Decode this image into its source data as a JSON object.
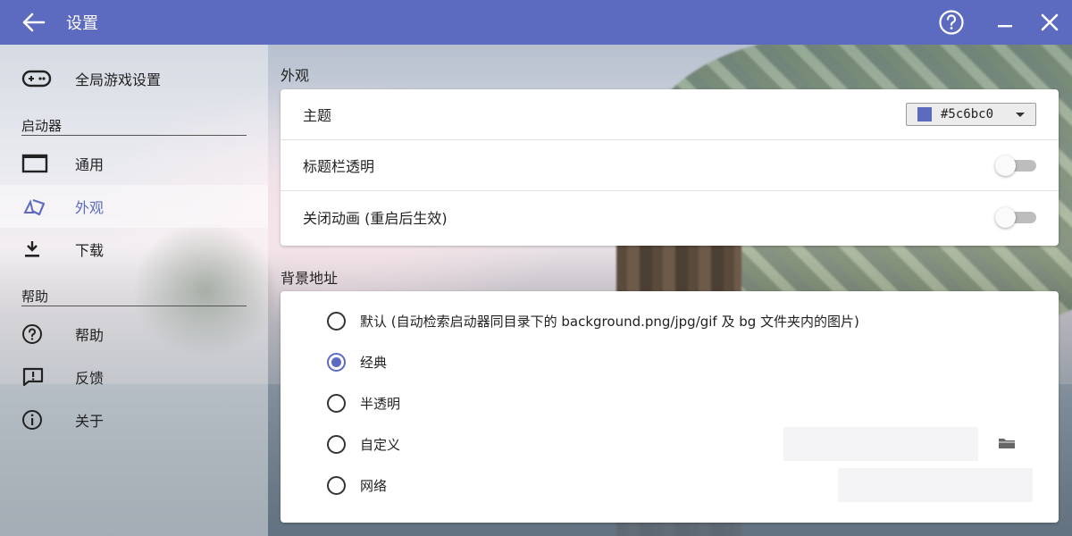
{
  "window": {
    "title": "设置",
    "accent_color": "#5c6bc0"
  },
  "titlebar": {
    "back_icon": "arrow-left-icon",
    "help_icon": "help-circle-icon",
    "minimize_icon": "minimize-icon",
    "close_icon": "close-icon"
  },
  "sidebar": {
    "top_item": {
      "label": "全局游戏设置",
      "icon": "gamepad-icon"
    },
    "section_launcher": "启动器",
    "launcher_items": [
      {
        "label": "通用",
        "icon": "window-icon"
      },
      {
        "label": "外观",
        "icon": "palette-icon",
        "active": true
      },
      {
        "label": "下载",
        "icon": "download-icon"
      }
    ],
    "section_help": "帮助",
    "help_items": [
      {
        "label": "帮助",
        "icon": "help-circle-icon"
      },
      {
        "label": "反馈",
        "icon": "feedback-icon"
      },
      {
        "label": "关于",
        "icon": "info-icon"
      }
    ]
  },
  "appearance": {
    "title": "外观",
    "theme_label": "主题",
    "theme_value": "#5c6bc0",
    "titlebar_transparent_label": "标题栏透明",
    "titlebar_transparent_on": false,
    "disable_animation_label": "关闭动画 (重启后生效)",
    "disable_animation_on": false
  },
  "background": {
    "title": "背景地址",
    "options": [
      {
        "label": "默认 (自动检索启动器同目录下的 background.png/jpg/gif 及 bg 文件夹内的图片)",
        "checked": false
      },
      {
        "label": "经典",
        "checked": true
      },
      {
        "label": "半透明",
        "checked": false
      },
      {
        "label": "自定义",
        "checked": false
      },
      {
        "label": "网络",
        "checked": false
      }
    ],
    "custom_path_value": "",
    "custom_folder_icon": "folder-icon",
    "network_url_value": ""
  }
}
